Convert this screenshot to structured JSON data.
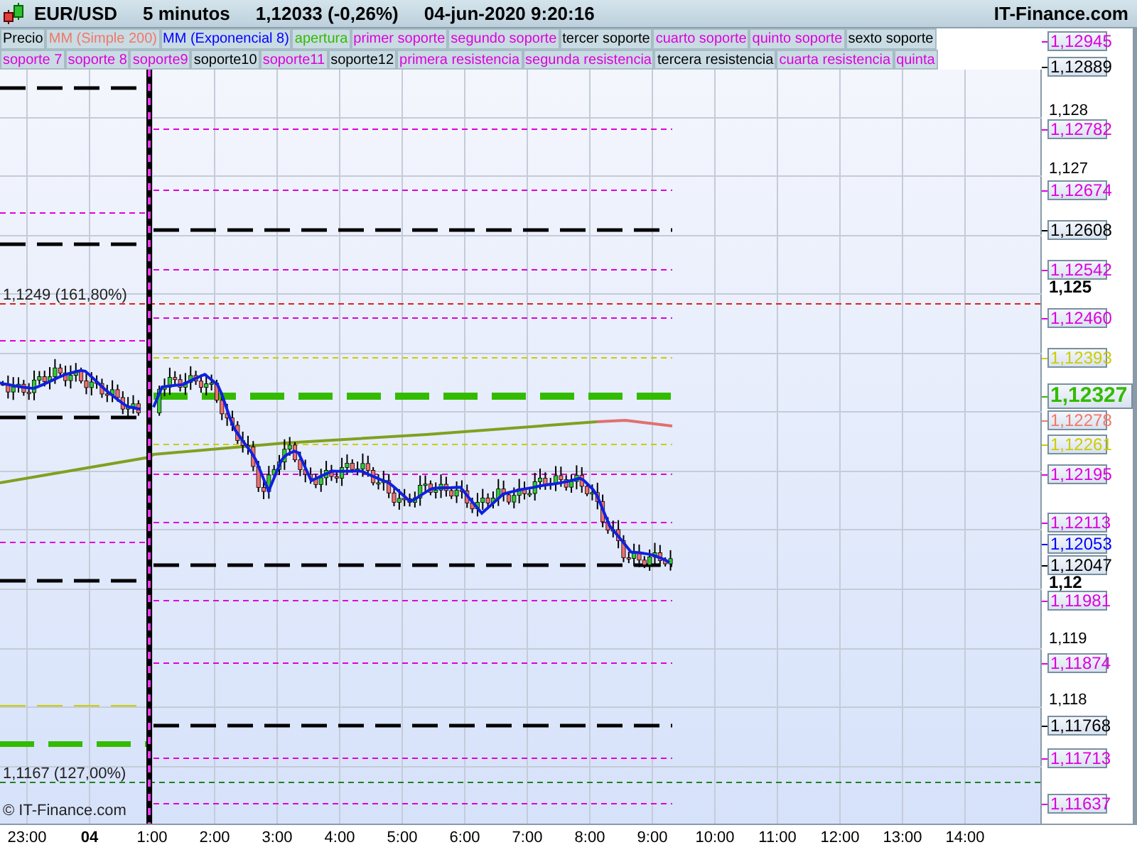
{
  "header": {
    "symbol": "EUR/USD",
    "interval": "5 minutos",
    "price": "1,12033 (-0,26%)",
    "datetime": "04-jun-2020 9:20:16",
    "site": "IT-Finance.com"
  },
  "legend_rows": [
    {
      "items": [
        {
          "label": "Precio",
          "color": "#000000"
        },
        {
          "label": "MM (Simple 200)",
          "color": "#f07868"
        },
        {
          "label": "MM (Exponencial 8)",
          "color": "#0000ff"
        },
        {
          "label": "apertura",
          "color": "#33bb00"
        },
        {
          "label": "primer soporte",
          "color": "#dd00dd"
        },
        {
          "label": "segundo soporte",
          "color": "#dd00dd"
        },
        {
          "label": "tercer soporte",
          "color": "#000000"
        },
        {
          "label": "cuarto soporte",
          "color": "#dd00dd"
        },
        {
          "label": "quinto soporte",
          "color": "#dd00dd"
        },
        {
          "label": "sexto soporte",
          "color": "#000000"
        }
      ]
    },
    {
      "items": [
        {
          "label": "soporte 7",
          "color": "#dd00dd"
        },
        {
          "label": "soporte 8",
          "color": "#dd00dd"
        },
        {
          "label": "soporte9",
          "color": "#dd00dd"
        },
        {
          "label": "soporte10",
          "color": "#000000"
        },
        {
          "label": "soporte11",
          "color": "#dd00dd"
        },
        {
          "label": "soporte12",
          "color": "#000000"
        },
        {
          "label": "primera resistencia",
          "color": "#dd00dd"
        },
        {
          "label": "segunda resistencia",
          "color": "#dd00dd"
        },
        {
          "label": "tercera resistencia",
          "color": "#000000"
        },
        {
          "label": "cuarta resistencia",
          "color": "#dd00dd"
        },
        {
          "label": "quinta",
          "color": "#dd00dd"
        }
      ]
    }
  ],
  "annotations": [
    {
      "text": "1,1249 (161,80%)"
    },
    {
      "text": "1,1167 (127,00%)"
    }
  ],
  "credit": "© IT-Finance.com",
  "price_axis": {
    "ticks": [
      {
        "label": "1,128",
        "bold": false
      },
      {
        "label": "1,127",
        "bold": false
      },
      {
        "label": "1,125",
        "bold": true
      },
      {
        "label": "1,12",
        "bold": true
      },
      {
        "label": "1,119",
        "bold": false
      },
      {
        "label": "1,118",
        "bold": false
      }
    ],
    "labels": [
      {
        "text": "1,12945",
        "color": "#dd00dd",
        "kind": "level"
      },
      {
        "text": "1,12889",
        "color": "#000000",
        "kind": "level"
      },
      {
        "text": "1,12782",
        "color": "#dd00dd",
        "kind": "level"
      },
      {
        "text": "1,12674",
        "color": "#dd00dd",
        "kind": "level"
      },
      {
        "text": "1,12608",
        "color": "#000000",
        "kind": "level"
      },
      {
        "text": "1,12542",
        "color": "#dd00dd",
        "kind": "level"
      },
      {
        "text": "1,12460",
        "color": "#dd00dd",
        "kind": "level"
      },
      {
        "text": "1,12393",
        "color": "#cccc00",
        "kind": "level"
      },
      {
        "text": "1,12327",
        "color": "#33bb00",
        "kind": "current"
      },
      {
        "text": "1,12278",
        "color": "#f07868",
        "kind": "level"
      },
      {
        "text": "1,12261",
        "color": "#cccc00",
        "kind": "level"
      },
      {
        "text": "1,12195",
        "color": "#dd00dd",
        "kind": "level"
      },
      {
        "text": "1,12113",
        "color": "#dd00dd",
        "kind": "level"
      },
      {
        "text": "1,12053",
        "color": "#0000ff",
        "kind": "level"
      },
      {
        "text": "1,12047",
        "color": "#000000",
        "kind": "level"
      },
      {
        "text": "1,11981",
        "color": "#dd00dd",
        "kind": "level"
      },
      {
        "text": "1,11874",
        "color": "#dd00dd",
        "kind": "level"
      },
      {
        "text": "1,11768",
        "color": "#000000",
        "kind": "level"
      },
      {
        "text": "1,11713",
        "color": "#dd00dd",
        "kind": "level"
      },
      {
        "text": "1,11637",
        "color": "#dd00dd",
        "kind": "level"
      }
    ]
  },
  "time_axis": [
    {
      "label": "23:00",
      "bold": false
    },
    {
      "label": "04",
      "bold": true
    },
    {
      "label": "1:00",
      "bold": false
    },
    {
      "label": "2:00",
      "bold": false
    },
    {
      "label": "3:00",
      "bold": false
    },
    {
      "label": "4:00",
      "bold": false
    },
    {
      "label": "5:00",
      "bold": false
    },
    {
      "label": "6:00",
      "bold": false
    },
    {
      "label": "7:00",
      "bold": false
    },
    {
      "label": "8:00",
      "bold": false
    },
    {
      "label": "9:00",
      "bold": false
    },
    {
      "label": "10:00",
      "bold": false
    },
    {
      "label": "11:00",
      "bold": false
    },
    {
      "label": "12:00",
      "bold": false
    },
    {
      "label": "13:00",
      "bold": false
    },
    {
      "label": "14:00",
      "bold": false
    }
  ]
}
